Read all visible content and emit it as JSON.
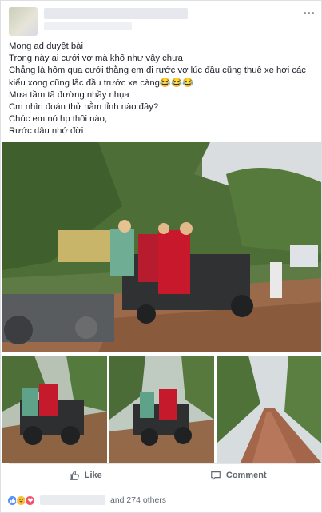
{
  "post": {
    "lines": [
      "Mong ad duyệt bài",
      "Trong này ai cưới vợ mà khổ như vậy chưa",
      "Chẳng là hôm qua cưới thằng em đi rước vợ lúc đầu cũng thuê xe hơi các kiểu xong cũng lắc đầu trước xe càng😂😂😂",
      "Mưa tầm tã đường nhầy nhụa",
      "Cm nhìn đoán thử nằm tỉnh nào đây?",
      "Chúc em nó hp thôi nào,",
      "Rước dâu nhớ đời"
    ]
  },
  "actions": {
    "like_label": "Like",
    "comment_label": "Comment"
  },
  "reactions": {
    "others_text": "and 274 others",
    "types": [
      "like",
      "haha",
      "love"
    ]
  },
  "colors": {
    "link": "#4267b2",
    "secondary_text": "#606770",
    "border": "#dddfe2"
  }
}
